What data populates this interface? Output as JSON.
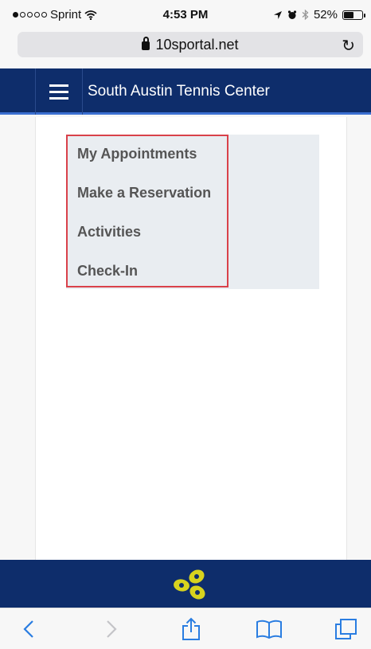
{
  "status": {
    "carrier": "Sprint",
    "time": "4:53 PM",
    "battery": "52%",
    "battery_level": 0.52,
    "signal_bars": 1
  },
  "browser": {
    "url": "10sportal.net"
  },
  "header": {
    "title": "South Austin Tennis Center"
  },
  "menu": {
    "items": [
      {
        "label": "My Appointments"
      },
      {
        "label": "Make a Reservation"
      },
      {
        "label": "Activities"
      },
      {
        "label": "Check-In"
      }
    ]
  },
  "colors": {
    "header_bg": "#0e2d6b",
    "logo": "#d7d31e",
    "highlight_border": "#d9414a",
    "toolbar_icon": "#2a7de1"
  },
  "icons": {
    "toolbar": [
      "back-icon",
      "forward-icon",
      "share-icon",
      "bookmarks-icon",
      "tabs-icon"
    ]
  }
}
